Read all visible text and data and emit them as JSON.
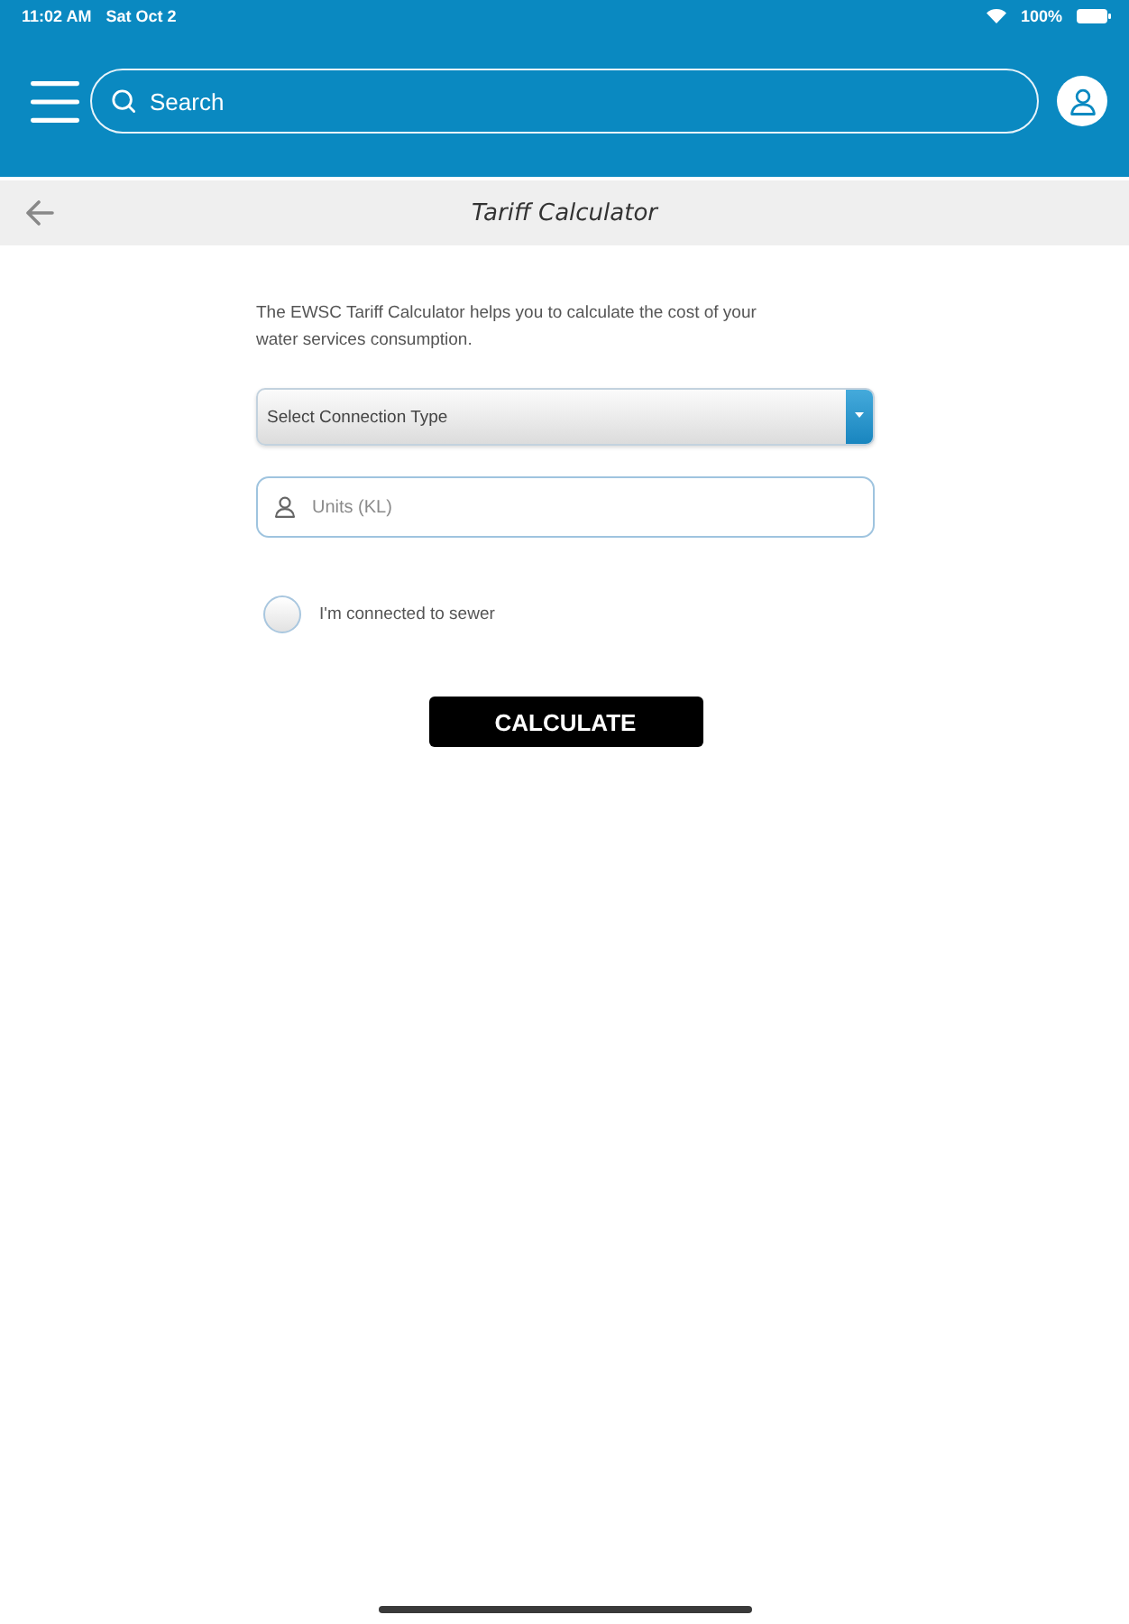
{
  "status_bar": {
    "time": "11:02 AM",
    "date": "Sat Oct 2",
    "battery": "100%"
  },
  "header": {
    "search": {
      "placeholder": "Search"
    }
  },
  "title_bar": {
    "title": "Tariff Calculator"
  },
  "form": {
    "intro": "The EWSC Tariff Calculator helps you to calculate the cost of your water services consumption.",
    "connection_type": {
      "placeholder": "Select Connection Type"
    },
    "units": {
      "placeholder": "Units (KL)"
    },
    "sewer": {
      "label": "I'm connected to sewer",
      "checked": false
    },
    "button": "CALCULATE"
  }
}
